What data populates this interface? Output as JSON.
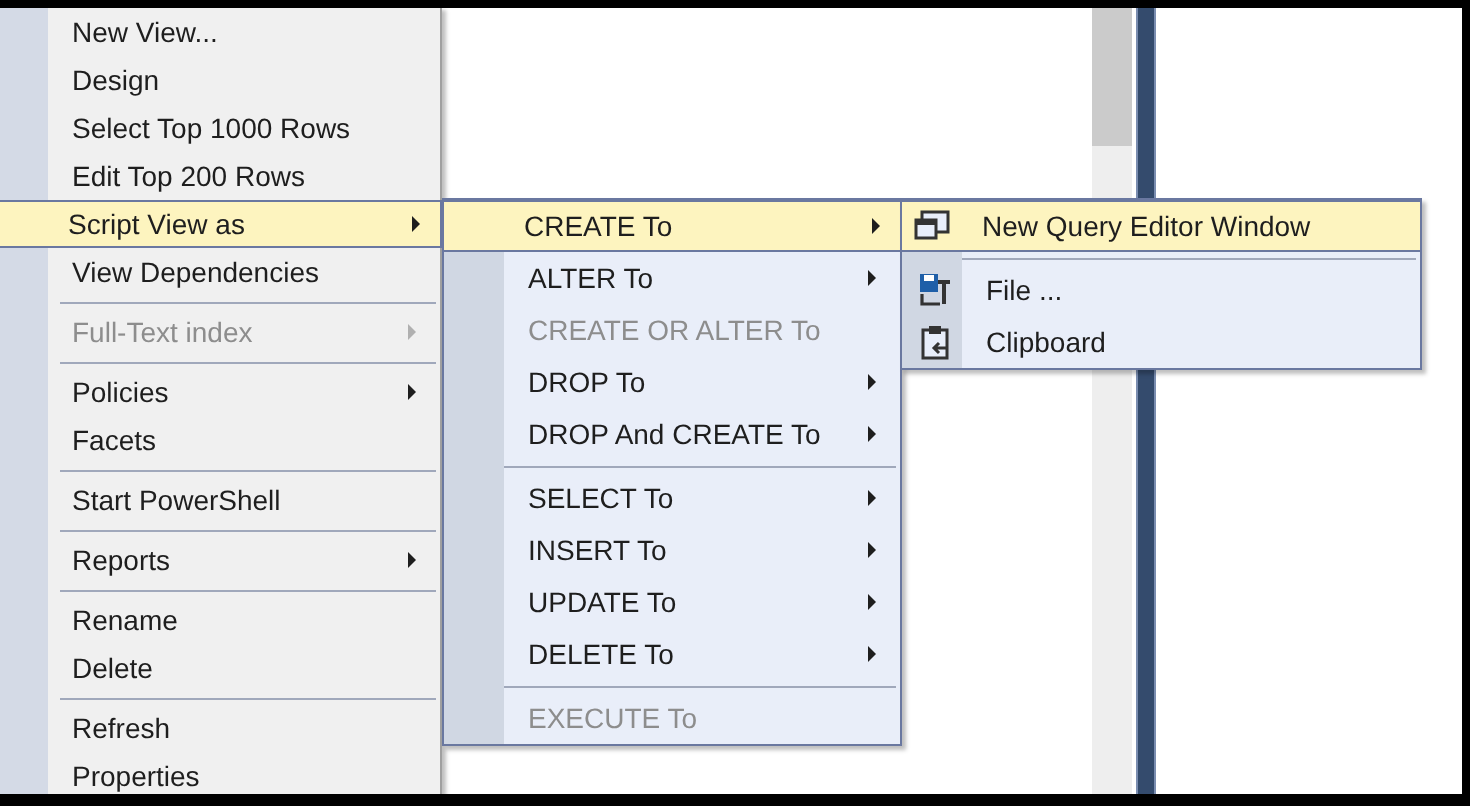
{
  "menus": [
    {
      "items": [
        {
          "kind": "item",
          "label": "New View...",
          "disabled": false,
          "selected": false,
          "submenu": false
        },
        {
          "kind": "item",
          "label": "Design",
          "disabled": false,
          "selected": false,
          "submenu": false
        },
        {
          "kind": "item",
          "label": "Select Top 1000 Rows",
          "disabled": false,
          "selected": false,
          "submenu": false
        },
        {
          "kind": "item",
          "label": "Edit Top 200 Rows",
          "disabled": false,
          "selected": false,
          "submenu": false
        },
        {
          "kind": "item",
          "label": "Script View as",
          "disabled": false,
          "selected": true,
          "submenu": true
        },
        {
          "kind": "item",
          "label": "View Dependencies",
          "disabled": false,
          "selected": false,
          "submenu": false
        },
        {
          "kind": "separator"
        },
        {
          "kind": "item",
          "label": "Full-Text index",
          "disabled": true,
          "selected": false,
          "submenu": true
        },
        {
          "kind": "separator"
        },
        {
          "kind": "item",
          "label": "Policies",
          "disabled": false,
          "selected": false,
          "submenu": true
        },
        {
          "kind": "item",
          "label": "Facets",
          "disabled": false,
          "selected": false,
          "submenu": false
        },
        {
          "kind": "separator"
        },
        {
          "kind": "item",
          "label": "Start PowerShell",
          "disabled": false,
          "selected": false,
          "submenu": false
        },
        {
          "kind": "separator"
        },
        {
          "kind": "item",
          "label": "Reports",
          "disabled": false,
          "selected": false,
          "submenu": true
        },
        {
          "kind": "separator"
        },
        {
          "kind": "item",
          "label": "Rename",
          "disabled": false,
          "selected": false,
          "submenu": false
        },
        {
          "kind": "item",
          "label": "Delete",
          "disabled": false,
          "selected": false,
          "submenu": false
        },
        {
          "kind": "separator"
        },
        {
          "kind": "item",
          "label": "Refresh",
          "disabled": false,
          "selected": false,
          "submenu": false
        },
        {
          "kind": "item",
          "label": "Properties",
          "disabled": false,
          "selected": false,
          "submenu": false
        }
      ]
    },
    {
      "items": [
        {
          "kind": "item",
          "label": "CREATE To",
          "disabled": false,
          "selected": true,
          "submenu": true
        },
        {
          "kind": "item",
          "label": "ALTER To",
          "disabled": false,
          "selected": false,
          "submenu": true
        },
        {
          "kind": "item",
          "label": "CREATE OR ALTER To",
          "disabled": true,
          "selected": false,
          "submenu": false
        },
        {
          "kind": "item",
          "label": "DROP To",
          "disabled": false,
          "selected": false,
          "submenu": true
        },
        {
          "kind": "item",
          "label": "DROP And CREATE To",
          "disabled": false,
          "selected": false,
          "submenu": true
        },
        {
          "kind": "separator"
        },
        {
          "kind": "item",
          "label": "SELECT To",
          "disabled": false,
          "selected": false,
          "submenu": true
        },
        {
          "kind": "item",
          "label": "INSERT To",
          "disabled": false,
          "selected": false,
          "submenu": true
        },
        {
          "kind": "item",
          "label": "UPDATE To",
          "disabled": false,
          "selected": false,
          "submenu": true
        },
        {
          "kind": "item",
          "label": "DELETE To",
          "disabled": false,
          "selected": false,
          "submenu": true
        },
        {
          "kind": "separator"
        },
        {
          "kind": "item",
          "label": "EXECUTE To",
          "disabled": true,
          "selected": false,
          "submenu": false
        }
      ]
    },
    {
      "items": [
        {
          "kind": "item",
          "label": "New Query Editor Window",
          "disabled": false,
          "selected": true,
          "submenu": false
        },
        {
          "kind": "separator"
        },
        {
          "kind": "item",
          "label": "File ...",
          "disabled": false,
          "selected": false,
          "submenu": false
        },
        {
          "kind": "item",
          "label": "Clipboard",
          "disabled": false,
          "selected": false,
          "submenu": false
        }
      ]
    }
  ]
}
